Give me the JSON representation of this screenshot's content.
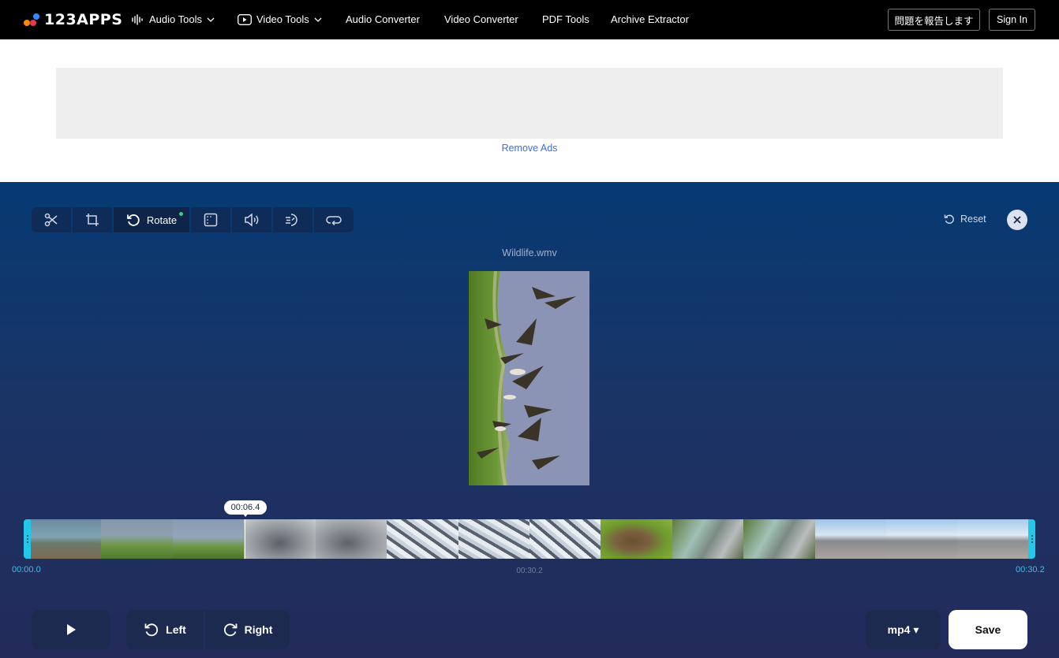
{
  "header": {
    "logo_text": "123APPS",
    "nav": [
      {
        "label": "Audio Tools",
        "icon": "waveform-icon",
        "has_dropdown": true
      },
      {
        "label": "Video Tools",
        "icon": "play-icon",
        "has_dropdown": true
      },
      {
        "label": "Audio Converter"
      },
      {
        "label": "Video Converter"
      },
      {
        "label": "PDF Tools"
      },
      {
        "label": "Archive Extractor"
      }
    ],
    "report_button": "問題を報告します",
    "signin_button": "Sign In"
  },
  "ads": {
    "remove_ads_link": "Remove Ads"
  },
  "editor": {
    "toolbar": {
      "tools": [
        {
          "name": "cut",
          "icon": "scissors-icon"
        },
        {
          "name": "crop",
          "icon": "crop-icon"
        },
        {
          "name": "rotate",
          "icon": "rotate-icon",
          "label": "Rotate",
          "active": true
        },
        {
          "name": "resize",
          "icon": "frame-icon"
        },
        {
          "name": "volume",
          "icon": "volume-icon"
        },
        {
          "name": "speed",
          "icon": "speed-icon"
        },
        {
          "name": "loop",
          "icon": "loop-icon"
        }
      ],
      "reset_label": "Reset"
    },
    "filename": "Wildlife.wmv",
    "timeline": {
      "playhead_time": "00:06.4",
      "start_time": "00:00.0",
      "duration": "00:30.2",
      "end_time": "00:30.2",
      "playhead_position": 0.212
    },
    "controls": {
      "rotate_left_label": "Left",
      "rotate_right_label": "Right",
      "format_label": "mp4 ▾",
      "save_label": "Save"
    }
  },
  "colors": {
    "accent_cyan": "#22c7ea",
    "link_blue": "#3f6fd8",
    "active_dot": "#2ed47a"
  }
}
